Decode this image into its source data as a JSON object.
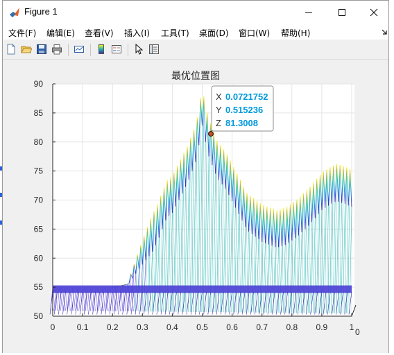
{
  "window": {
    "title": "Figure 1"
  },
  "menu": [
    "文件(F)",
    "编辑(E)",
    "查看(V)",
    "插入(I)",
    "工具(T)",
    "桌面(D)",
    "窗口(W)",
    "帮助(H)"
  ],
  "toolbar_icons": [
    "new-figure-icon",
    "open-file-icon",
    "save-icon",
    "print-icon",
    "link-plot-icon",
    "insert-colorbar-icon",
    "insert-legend-icon",
    "edit-plot-arrow-icon",
    "property-inspector-icon"
  ],
  "datatip": {
    "x_label": "X",
    "x_value": "0.0721752",
    "y_label": "Y",
    "y_value": "0.515236",
    "z_label": "Z",
    "z_value": "81.3008"
  },
  "chart_data": {
    "type": "surface",
    "title": "最优位置图",
    "xlabel": "",
    "ylabel": "",
    "zlabel": "",
    "x_ticks": [
      "0",
      "0.1",
      "0.2",
      "0.3",
      "0.4",
      "0.5",
      "0.6",
      "0.7",
      "0.8",
      "0.9",
      "1"
    ],
    "z_ticks": [
      "50",
      "55",
      "60",
      "65",
      "70",
      "75",
      "80",
      "85",
      "90"
    ],
    "y_tick_visible": "0",
    "xlim": [
      0,
      1
    ],
    "zlim": [
      50,
      90
    ],
    "grid": true,
    "colormap": "parula",
    "colors": {
      "low": "#3e26a8",
      "mid": "#1fb3b0",
      "high": "#f9fb0e",
      "datatip_value": "#0099dd"
    },
    "ridge_profile": {
      "x": [
        0,
        0.1,
        0.2,
        0.25,
        0.3,
        0.35,
        0.38,
        0.4,
        0.42,
        0.45,
        0.48,
        0.5,
        0.52,
        0.55,
        0.58,
        0.6,
        0.65,
        0.7,
        0.75,
        0.78,
        0.82,
        0.86,
        0.9,
        0.93,
        0.95,
        0.98,
        1.0
      ],
      "z": [
        55,
        55,
        55,
        55.5,
        61,
        66,
        70,
        71,
        73,
        76,
        80,
        86,
        81,
        77,
        75,
        73,
        68,
        66,
        65,
        65.5,
        67,
        69,
        71.5,
        72.5,
        73,
        72.5,
        72
      ]
    }
  }
}
